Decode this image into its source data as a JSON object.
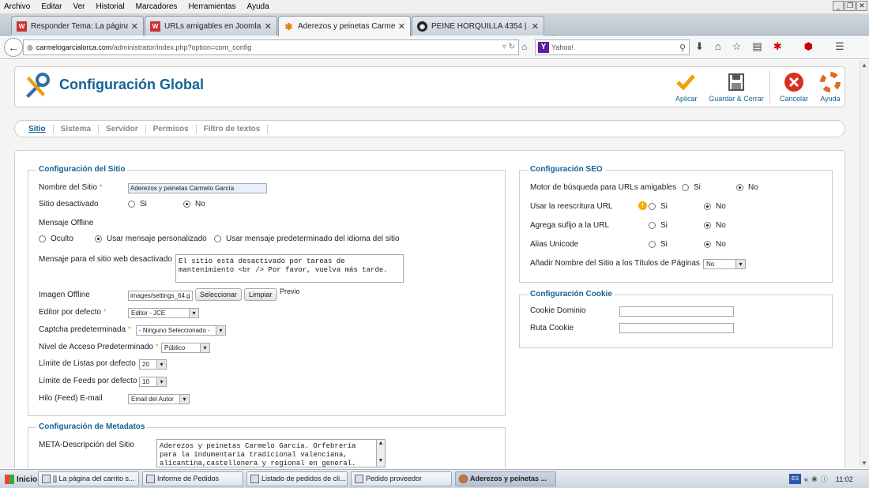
{
  "menubar": {
    "items": [
      "Archivo",
      "Editar",
      "Ver",
      "Historial",
      "Marcadores",
      "Herramientas",
      "Ayuda"
    ]
  },
  "tabs": [
    {
      "title": "Responder Tema: La página d...",
      "active": false
    },
    {
      "title": "URLs amigables en Joomla! - ...",
      "active": false
    },
    {
      "title": "Aderezos y peinetas Carmelo ...",
      "active": true
    },
    {
      "title": "PEINE HORQUILLA 4354 | Ad...",
      "active": false
    }
  ],
  "nav": {
    "url_domain": "carmelogarcialorca.com",
    "url_path": "/administrator/index.php?option=com_config",
    "search_placeholder": "Yahoo!"
  },
  "header": {
    "title": "Configuración Global",
    "buttons": {
      "apply": "Aplicar",
      "save_close": "Guardar & Cerrar",
      "cancel": "Cancelar",
      "help": "Ayuda"
    }
  },
  "subnav": {
    "tabs": [
      "Sitio",
      "Sistema",
      "Servidor",
      "Permisos",
      "Filtro de textos"
    ]
  },
  "site": {
    "legend": "Configuración del Sitio",
    "site_name_label": "Nombre del Sitio",
    "site_name_value": "Aderezos y peinetas Carmelo García",
    "offline_label": "Sitio desactivado",
    "yes": "Si",
    "no": "No",
    "offline_message_label": "Mensaje Offline",
    "opt_hidden": "Oculto",
    "opt_custom": "Usar mensaje personalizado",
    "opt_default": "Usar mensaje predeterminado del idioma del sitio",
    "offline_text_label": "Mensaje para el sitio web desactivado",
    "offline_text_value": "El sitio está desactivado por tareas de mantenimiento <br /> Por favor, vuelva más tarde.",
    "offline_image_label": "Imagen Offline",
    "offline_image_value": "images/settings_64.g",
    "select_btn": "Seleccionar",
    "clear_btn": "Limpiar",
    "preview": "Previo",
    "editor_label": "Editor por defecto",
    "editor_value": "Editor - JCE",
    "captcha_label": "Captcha predeterminada",
    "captcha_value": "- Ninguno Seleccionado -",
    "access_label": "Nivel de Acceso Predeterminado",
    "access_value": "Público",
    "list_limit_label": "Límite de Listas por defecto",
    "list_limit_value": "20",
    "feed_limit_label": "Límite de Feeds por defecto",
    "feed_limit_value": "10",
    "feed_email_label": "Hilo (Feed) E-mail",
    "feed_email_value": "Email del Autor"
  },
  "metadata": {
    "legend": "Configuración de Metadatos",
    "meta_desc_label": "META-Descripción del Sitio",
    "meta_desc_value": "Aderezos y peinetas Carmelo García. Orfebrería para la indumentaria tradicional valenciana, alicantina,castellonera y regional en general."
  },
  "seo": {
    "legend": "Configuración SEO",
    "sef_label": "Motor de búsqueda para URLs amigables",
    "rewrite_label": "Usar la reescritura URL",
    "suffix_label": "Agrega sufijo a la URL",
    "unicode_label": "Alias Unicode",
    "sitename_titles_label": "Añadir Nombre del Sitio a los Títulos de Páginas",
    "sitename_titles_value": "No",
    "yes": "Si",
    "no": "No"
  },
  "cookie": {
    "legend": "Configuración Cookie",
    "domain_label": "Cookie Dominio",
    "path_label": "Ruta Cookie"
  },
  "taskbar": {
    "start": "Inicio",
    "tasks": [
      "[] La página del carrito s...",
      "Informe de Pedidos",
      "Listado de pedidos de cli...",
      "Pedido proveedor",
      "Aderezos y peinetas ..."
    ],
    "lang": "ES",
    "clock": "11:02"
  }
}
